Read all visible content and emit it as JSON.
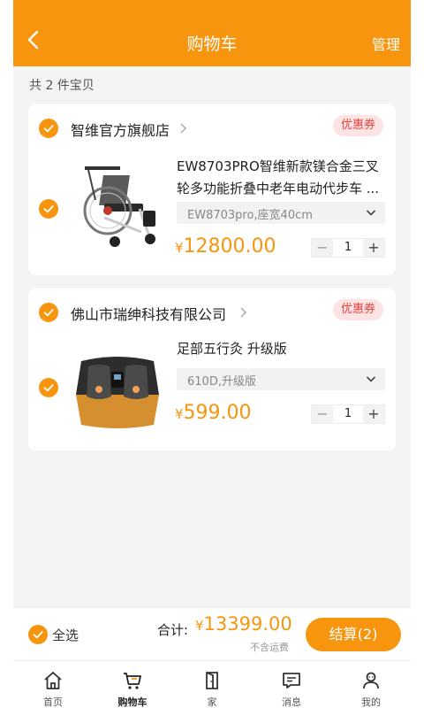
{
  "header": {
    "title": "购物车",
    "manage_label": "管理"
  },
  "cart_count_text": "共 2 件宝贝",
  "colors": {
    "accent": "#f7950f",
    "coupon_text": "#e8413c",
    "coupon_bg": "#fde3e3"
  },
  "shops": [
    {
      "name": "智维官方旗舰店",
      "coupon_label": "优惠券",
      "item": {
        "title": "EW8703PRO智维新款镁合金三叉轮多功能折叠中老年电动代步车 ...",
        "spec": "EW8703pro,座宽40cm",
        "currency": "¥",
        "price": "12800.00",
        "quantity": "1",
        "image": "wheelchair"
      }
    },
    {
      "name": "佛山市瑞绅科技有限公司",
      "coupon_label": "优惠券",
      "item": {
        "title": "足部五行灸 升级版",
        "spec": "610D,升级版",
        "currency": "¥",
        "price": "599.00",
        "quantity": "1",
        "image": "foot-massager"
      }
    }
  ],
  "stepper": {
    "minus": "−",
    "plus": "+"
  },
  "footer": {
    "select_all_label": "全选",
    "total_label": "合计:",
    "currency": "¥",
    "total_amount": "13399.00",
    "shipping_note": "不含运费",
    "checkout_label": "结算(2)"
  },
  "tabbar": [
    {
      "label": "首页",
      "icon": "home-icon"
    },
    {
      "label": "购物车",
      "icon": "cart-icon",
      "active": true
    },
    {
      "label": "家",
      "icon": "door-icon"
    },
    {
      "label": "消息",
      "icon": "message-icon"
    },
    {
      "label": "我的",
      "icon": "user-icon"
    }
  ]
}
